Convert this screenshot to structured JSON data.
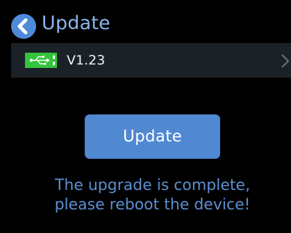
{
  "header": {
    "title": "Update",
    "back_icon": "chevron-left-icon"
  },
  "firmware_row": {
    "icon": "usb-icon",
    "version": "V1.23",
    "chevron_icon": "chevron-right-icon"
  },
  "update_button": {
    "label": "Update"
  },
  "status": {
    "line1": "The upgrade is complete,",
    "line2": "please reboot the device!"
  },
  "colors": {
    "background": "#000000",
    "accent": "#4f8ad8",
    "title": "#8ab8ec",
    "usb_green": "#35c43d",
    "row_background": "#1b2227",
    "status_text": "#5b8fd0"
  }
}
